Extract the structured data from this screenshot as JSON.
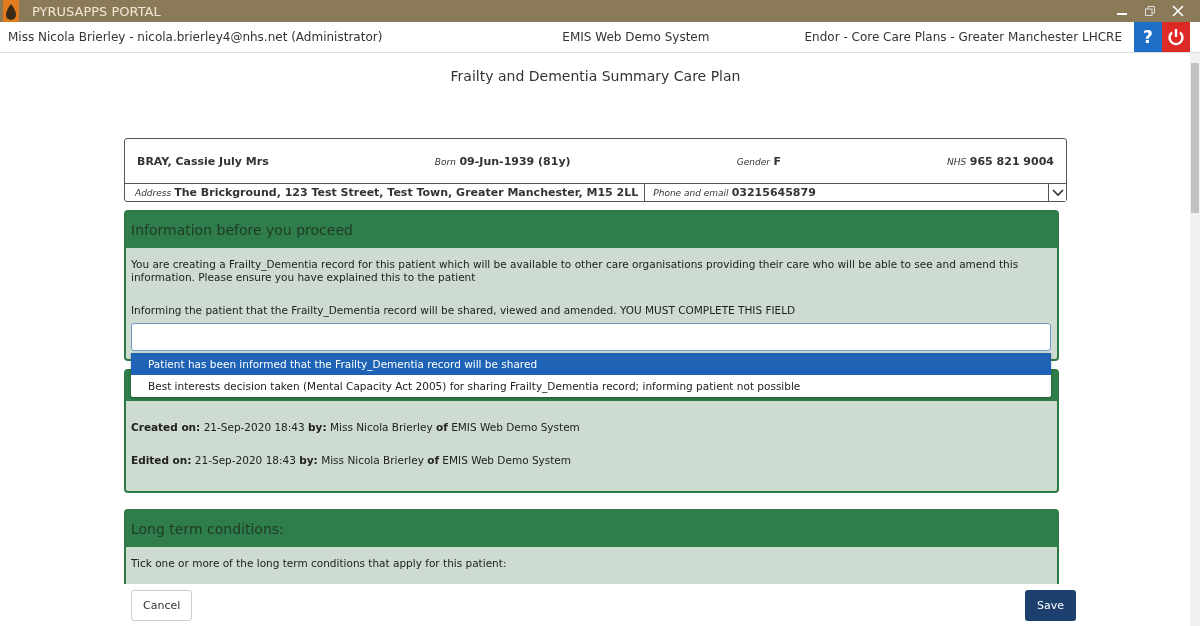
{
  "window": {
    "title": "PYRUSAPPS PORTAL"
  },
  "info_bar": {
    "user": "Miss Nicola Brierley - nicola.brierley4@nhs.net (Administrator)",
    "system": "EMIS Web Demo System",
    "organisation": "Endor - Core Care Plans - Greater Manchester LHCRE",
    "help": "?"
  },
  "page_title": "Frailty and Dementia Summary Care Plan",
  "patient": {
    "name": "BRAY, Cassie July Mrs",
    "born_label": "Born",
    "born": "09-Jun-1939 (81y)",
    "gender_label": "Gender",
    "gender": "F",
    "nhs_label": "NHS",
    "nhs": "965 821 9004",
    "address_label": "Address",
    "address": "The Brickground, 123 Test Street, Test Town, Greater Manchester, M15 2LL",
    "phone_label": "Phone and email",
    "phone": "03215645879"
  },
  "info_panel": {
    "title": "Information before you proceed",
    "text": "You are creating a Frailty_Dementia record for this patient which will be available to other care organisations providing their care who will be able to see and amend this information. Please ensure you have explained this to the patient",
    "field_label": "Informing the patient that the Frailty_Dementia record will be shared, viewed and amended. YOU MUST COMPLETE THIS FIELD",
    "options": [
      {
        "label": "Patient has been informed that the Frailty_Dementia record will be shared",
        "selected": true
      },
      {
        "label": "Best interests decision taken (Mental Capacity Act 2005) for sharing Frailty_Dementia record; informing patient not possible",
        "selected": false
      }
    ]
  },
  "audit_panel": {
    "lines": [
      "**Created on:** 21-Sep-2020 18:43 **by:** Miss Nicola Brierley **of** EMIS Web Demo System",
      "**Edited on:** 21-Sep-2020 18:43 **by:** Miss Nicola Brierley **of** EMIS Web Demo System"
    ]
  },
  "conditions_panel": {
    "title": "Long term conditions:",
    "text": "Tick one or more of the long term conditions that apply for this patient:"
  },
  "buttons": {
    "cancel": "Cancel",
    "save": "Save"
  }
}
